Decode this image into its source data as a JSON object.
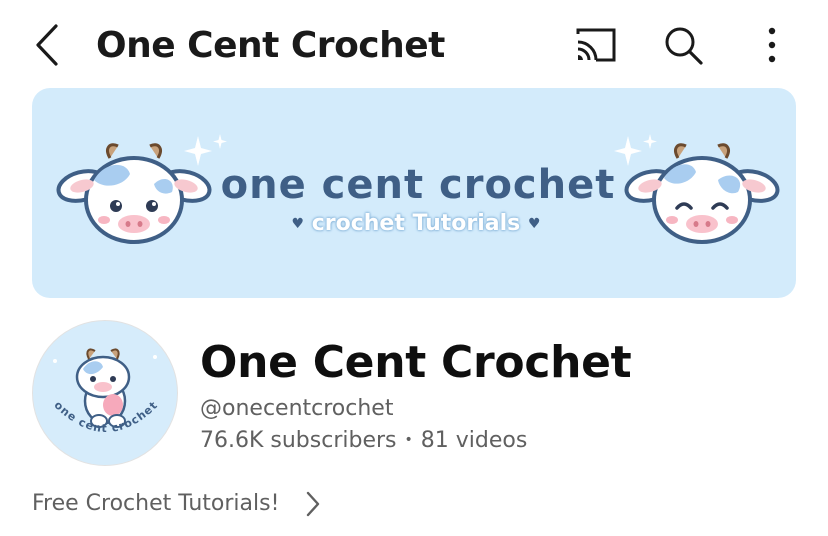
{
  "header": {
    "title": "One Cent Crochet"
  },
  "banner": {
    "title": "one cent crochet",
    "subtitle": "crochet Tutorials"
  },
  "avatar": {
    "text": "one cent crochet"
  },
  "channel": {
    "name": "One Cent Crochet",
    "handle": "@onecentcrochet",
    "subscribers": "76.6K subscribers",
    "separator": "•",
    "videos": "81 videos",
    "description": "Free Crochet Tutorials!"
  },
  "icons": {
    "back": "chevron-left-icon",
    "cast": "cast-icon",
    "search": "search-icon",
    "more": "more-vertical-icon",
    "description_more": "chevron-right-icon"
  },
  "colors": {
    "banner_bg": "#d3ebfb",
    "banner_text": "#3f5f86",
    "secondary_text": "#606060"
  }
}
